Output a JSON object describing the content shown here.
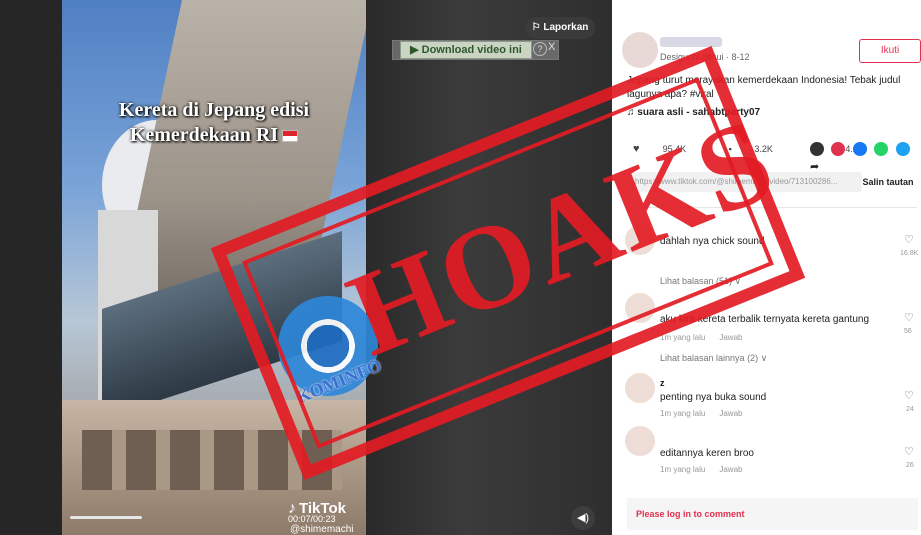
{
  "video": {
    "caption_line1": "Kereta di Jepang edisi",
    "caption_line2": "Kemerdekaan RI",
    "tiktok_brand": "TikTok",
    "time": "00:07/00:23",
    "handle": "@shimemachi",
    "report_label": "Laporkan",
    "download_label": "▶ Download video ini",
    "download_help": "?",
    "download_close": "X"
  },
  "post": {
    "author_meta": "Desiguchi desui · 8-12",
    "follow_label": "Ikuti",
    "description": "Jepang turut merayakan kemerdekaan Indonesia! Tebak judul lagunya apa? #viral",
    "music": "suara asli - sahabtparty07",
    "stats": [
      "95.4K",
      "3.2K",
      "4.2K"
    ],
    "link": "https://www.tiktok.com/@shimemachi/video/713100286...",
    "copy_label": "Salin tautan"
  },
  "share_colors": [
    "#333333",
    "#e0314f",
    "#1877f2",
    "#25d366",
    "#1da1f2"
  ],
  "comments": [
    {
      "name": "",
      "text": "dahlah nya chick sound",
      "meta_time": "",
      "meta_reply": "",
      "likes": "16.8K",
      "replies": "Lihat balasan (51) ∨"
    },
    {
      "name": "",
      "text": "aku kira kereta terbalik ternyata kereta gantung",
      "meta_time": "1m yang lalu",
      "meta_reply": "Jawab",
      "likes": "56",
      "replies": "Lihat balasan lainnya (2) ∨"
    },
    {
      "name": "z",
      "text": "penting nya buka sound",
      "meta_time": "1m yang lalu",
      "meta_reply": "Jawab",
      "likes": "24",
      "replies": ""
    },
    {
      "name": "",
      "text": "editannya keren broo",
      "meta_time": "1m yang lalu",
      "meta_reply": "Jawab",
      "likes": "26",
      "replies": ""
    }
  ],
  "login_prompt": "Please log in to comment",
  "overlay": {
    "stamp_text": "HOAKS",
    "logo_text": "KOMINFO"
  }
}
